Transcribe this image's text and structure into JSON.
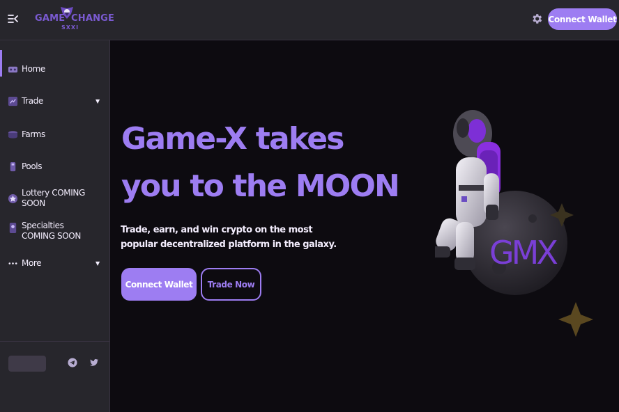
{
  "header": {
    "logo": {
      "word_left": "GAME",
      "word_right": "CHANGE",
      "sub": "SXXI"
    },
    "connect_wallet_label": "Connect Wallet",
    "icons": {
      "menu": "menu-collapse-icon",
      "settings": "gear-icon"
    }
  },
  "sidebar": {
    "items": [
      {
        "label": "Home",
        "icon": "home-icon",
        "active": true
      },
      {
        "label": "Trade",
        "icon": "trade-icon",
        "has_dropdown": true
      },
      {
        "label": "Farms",
        "icon": "farms-icon"
      },
      {
        "label": "Pools",
        "icon": "pools-icon"
      },
      {
        "label": "Lottery COMING SOON",
        "icon": "lottery-icon"
      },
      {
        "label": "Specialties COMING SOON",
        "icon": "specialties-icon"
      },
      {
        "label": "More",
        "icon": "more-icon",
        "has_dropdown": true
      }
    ],
    "socials": [
      "telegram-icon",
      "twitter-icon"
    ]
  },
  "hero": {
    "headline_line1": "Game-X takes",
    "headline_line2": "you to the MOON",
    "subtext": "Trade, earn, and win crypto on the most popular decentralized platform in the galaxy.",
    "connect_wallet_label": "Connect Wallet",
    "trade_now_label": "Trade Now",
    "mascot_text": "GMX"
  },
  "colors": {
    "accent": "#9d7df2",
    "panel": "#27262c",
    "background": "#0d0b10",
    "text": "#f4eefe"
  }
}
